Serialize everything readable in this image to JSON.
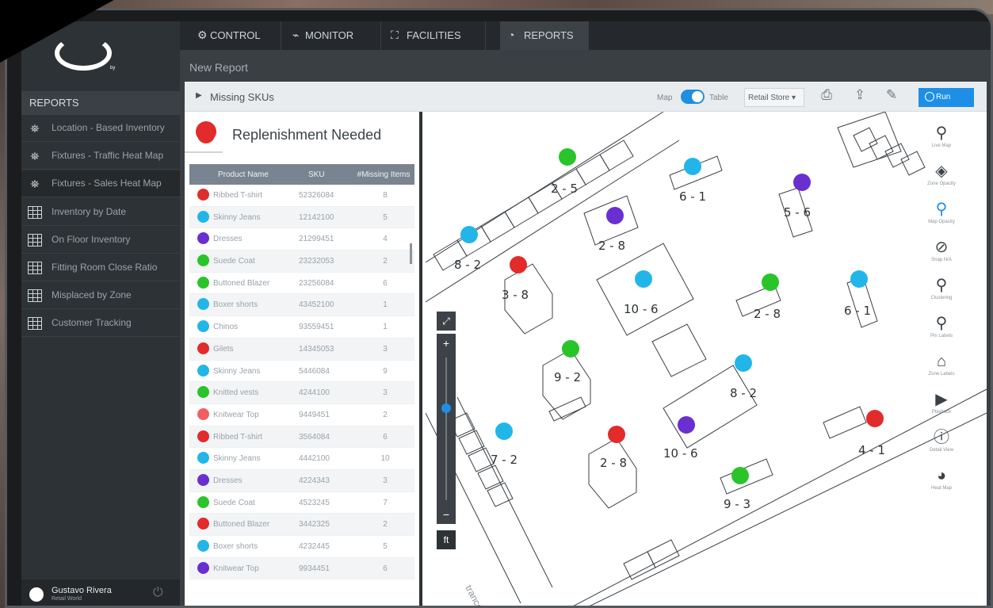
{
  "tabs": [
    {
      "label": "CONTROL",
      "icon": "gear-icon",
      "glyph": "⚙"
    },
    {
      "label": "MONITOR",
      "icon": "pulse-icon",
      "glyph": "⌁"
    },
    {
      "label": "FACILITIES",
      "icon": "floorplan-icon",
      "glyph": "⛶"
    },
    {
      "label": "REPORTS",
      "icon": "reports-icon",
      "glyph": "◔"
    }
  ],
  "page_title": "New Report",
  "sidebar": {
    "header": "REPORTS",
    "items": [
      {
        "label": "Location - Based Inventory",
        "icon": "location-person-icon",
        "glyph": "⛯"
      },
      {
        "label": "Fixtures - Traffic Heat Map",
        "icon": "fixtures-heat-icon",
        "glyph": "⛯"
      },
      {
        "label": "Fixtures - Sales Heat Map",
        "icon": "fixtures-heat-icon",
        "glyph": "⛯"
      },
      {
        "label": "Inventory by Date",
        "icon": "table-icon"
      },
      {
        "label": "On Floor Inventory",
        "icon": "table-icon"
      },
      {
        "label": "Fitting Room Close Ratio",
        "icon": "table-icon"
      },
      {
        "label": "Misplaced by Zone",
        "icon": "table-icon"
      },
      {
        "label": "Customer Tracking",
        "icon": "table-icon"
      }
    ],
    "active_index": 2,
    "logo_sub": "by",
    "user": {
      "name": "Gustavo Rivera",
      "org": "Retail World"
    }
  },
  "report": {
    "title": "Missing SKUs",
    "toggle_left": "Map",
    "toggle_right": "Table",
    "store": "Retail Store ▾",
    "run_label": "Run"
  },
  "list": {
    "title": "Replenishment Needed",
    "columns": [
      "Product Name",
      "SKU",
      "#Missing Items"
    ],
    "rows": [
      {
        "name": "Ribbed T-shirt",
        "sku": "52326084",
        "missing": "8",
        "color": "#e22b2b"
      },
      {
        "name": "Skinny Jeans",
        "sku": "12142100",
        "missing": "5",
        "color": "#22b6e8"
      },
      {
        "name": "Dresses",
        "sku": "21299451",
        "missing": "4",
        "color": "#6a2fd0"
      },
      {
        "name": "Suede Coat",
        "sku": "23232053",
        "missing": "2",
        "color": "#29c42a"
      },
      {
        "name": "Buttoned Blazer",
        "sku": "23256084",
        "missing": "6",
        "color": "#29c42a"
      },
      {
        "name": "Boxer shorts",
        "sku": "43452100",
        "missing": "1",
        "color": "#22b6e8"
      },
      {
        "name": "Chinos",
        "sku": "93559451",
        "missing": "1",
        "color": "#22b6e8"
      },
      {
        "name": "Gilets",
        "sku": "14345053",
        "missing": "3",
        "color": "#e22b2b"
      },
      {
        "name": "Skinny Jeans",
        "sku": "5446084",
        "missing": "9",
        "color": "#22b6e8"
      },
      {
        "name": "Knitted vests",
        "sku": "4244100",
        "missing": "3",
        "color": "#29c42a"
      },
      {
        "name": "Knitwear Top",
        "sku": "9449451",
        "missing": "2",
        "color": "#f06060"
      },
      {
        "name": "Ribbed T-shirt",
        "sku": "3564084",
        "missing": "6",
        "color": "#e22b2b"
      },
      {
        "name": "Skinny Jeans",
        "sku": "4442100",
        "missing": "10",
        "color": "#22b6e8"
      },
      {
        "name": "Dresses",
        "sku": "4224343",
        "missing": "3",
        "color": "#6a2fd0"
      },
      {
        "name": "Suede Coat",
        "sku": "4523245",
        "missing": "7",
        "color": "#29c42a"
      },
      {
        "name": "Buttoned Blazer",
        "sku": "3442325",
        "missing": "2",
        "color": "#e22b2b"
      },
      {
        "name": "Boxer shorts",
        "sku": "4232445",
        "missing": "5",
        "color": "#22b6e8"
      },
      {
        "name": "Knitwear Top",
        "sku": "9934451",
        "missing": "6",
        "color": "#6a2fd0"
      }
    ]
  },
  "map": {
    "zones": [
      {
        "label": "2 - 5",
        "color": "#29c42a"
      },
      {
        "label": "6 - 1",
        "color": "#22b6e8"
      },
      {
        "label": "5 - 6",
        "color": "#6a2fd0"
      },
      {
        "label": "2 - 8",
        "color": "#6a2fd0"
      },
      {
        "label": "8 - 2",
        "color": "#22b6e8"
      },
      {
        "label": "3 - 8",
        "color": "#e22b2b"
      },
      {
        "label": "10 - 6",
        "color": "#22b6e8"
      },
      {
        "label": "2 - 8",
        "color": "#29c42a"
      },
      {
        "label": "6 - 1",
        "color": "#22b6e8"
      },
      {
        "label": "9 - 2",
        "color": "#29c42a"
      },
      {
        "label": "8 - 2",
        "color": "#22b6e8"
      },
      {
        "label": "7 - 2",
        "color": "#22b6e8"
      },
      {
        "label": "2 - 8",
        "color": "#e22b2b"
      },
      {
        "label": "10 - 6",
        "color": "#6a2fd0"
      },
      {
        "label": "4 - 1",
        "color": "#e22b2b"
      },
      {
        "label": "9 - 3",
        "color": "#29c42a"
      }
    ],
    "entrance_text": "trance /",
    "unit": "ft",
    "zoom_in": "+",
    "zoom_out": "−",
    "tools": [
      {
        "label": "Live Map",
        "icon": "map-pin-icon",
        "glyph": "⚲"
      },
      {
        "label": "Zone Opacity",
        "icon": "zone-opacity-icon",
        "glyph": "◈"
      },
      {
        "label": "Map Opacity",
        "icon": "map-opacity-icon",
        "glyph": "⚲"
      },
      {
        "label": "Snap N/A",
        "icon": "compass-icon",
        "glyph": "⊘"
      },
      {
        "label": "Clustering",
        "icon": "cluster-icon",
        "glyph": "⚲"
      },
      {
        "label": "Pin Labels",
        "icon": "pin-label-icon",
        "glyph": "⚲"
      },
      {
        "label": "Zone Labels",
        "icon": "zone-label-icon",
        "glyph": "⌂"
      },
      {
        "label": "Playback",
        "icon": "play-icon",
        "glyph": "▶"
      },
      {
        "label": "Detail View",
        "icon": "info-icon",
        "glyph": "ⓘ"
      },
      {
        "label": "Heat Map",
        "icon": "heat-map-icon",
        "glyph": "◕"
      }
    ]
  }
}
